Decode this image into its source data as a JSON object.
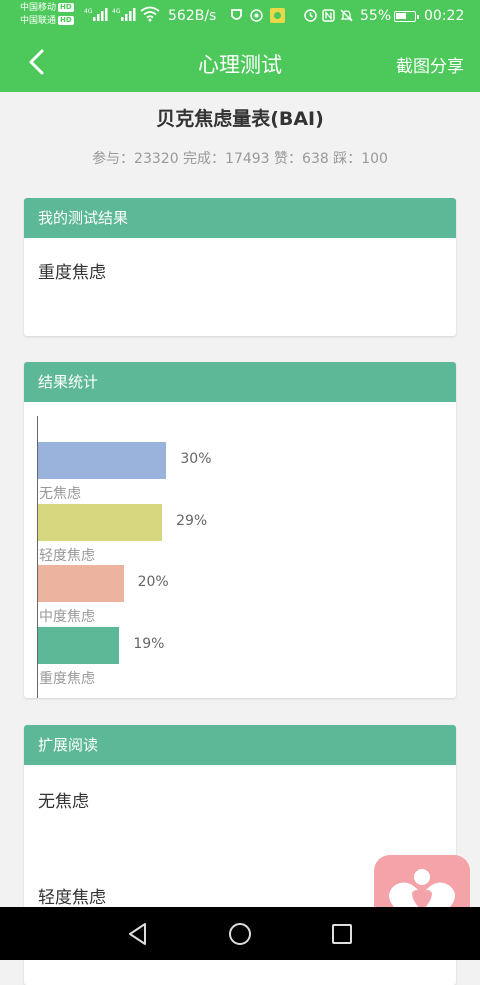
{
  "status_bar": {
    "carrier1": "中国移动",
    "carrier2": "中国联通",
    "hd": "HD",
    "net": "4G",
    "speed": "562B/s",
    "battery": "55%",
    "time": "00:22"
  },
  "navbar": {
    "title": "心理测试",
    "share_label": "截图分享"
  },
  "header": {
    "title": "贝克焦虑量表(BAI)",
    "stats": "参与：23320 完成：17493 赞：638 踩：100"
  },
  "result_card": {
    "title": "我的测试结果",
    "result": "重度焦虑"
  },
  "stats_card": {
    "title": "结果统计"
  },
  "chart_data": {
    "type": "bar",
    "orientation": "horizontal",
    "categories": [
      "无焦虑",
      "轻度焦虑",
      "中度焦虑",
      "重度焦虑"
    ],
    "values": [
      30,
      29,
      20,
      19
    ],
    "labels": [
      "30%",
      "29%",
      "20%",
      "19%"
    ],
    "colors": [
      "#9ab3dc",
      "#d6d67e",
      "#ecb49e",
      "#5cb897"
    ],
    "xlim": [
      0,
      100
    ]
  },
  "reading_card": {
    "title": "扩展阅读",
    "items": [
      "无焦虑",
      "轻度焦虑"
    ]
  }
}
